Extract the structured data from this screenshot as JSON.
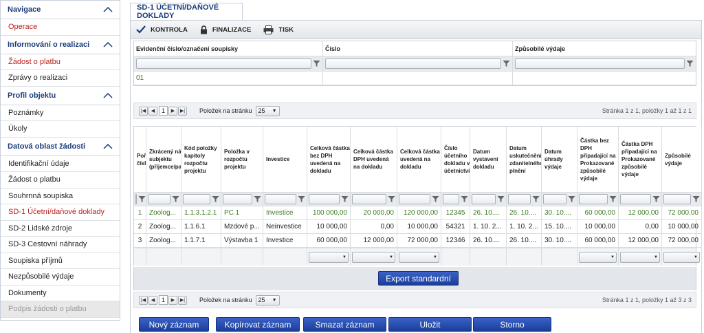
{
  "sidebar": {
    "sections": [
      {
        "title": "Navigace",
        "items": [
          {
            "label": "Operace",
            "state": "red"
          }
        ]
      },
      {
        "title": "Informování o realizaci",
        "items": [
          {
            "label": "Žádost o platbu",
            "state": "red"
          },
          {
            "label": "Zprávy o realizaci",
            "state": "normal"
          }
        ]
      },
      {
        "title": "Profil objektu",
        "items": [
          {
            "label": "Poznámky",
            "state": "normal"
          },
          {
            "label": "Úkoly",
            "state": "normal"
          }
        ]
      },
      {
        "title": "Datová oblast žádosti",
        "items": [
          {
            "label": "Identifikační údaje",
            "state": "normal"
          },
          {
            "label": "Žádost o platbu",
            "state": "normal"
          },
          {
            "label": "Souhrnná soupiska",
            "state": "normal"
          },
          {
            "label": "SD-1 Účetní/daňové doklady",
            "state": "red"
          },
          {
            "label": "SD-2 Lidské zdroje",
            "state": "normal"
          },
          {
            "label": "SD-3 Cestovní náhrady",
            "state": "normal"
          },
          {
            "label": "Soupiska příjmů",
            "state": "normal"
          },
          {
            "label": "Nezpůsobilé výdaje",
            "state": "normal"
          },
          {
            "label": "Dokumenty",
            "state": "normal"
          },
          {
            "label": "Podpis žádosti o platbu",
            "state": "disabled"
          }
        ]
      }
    ]
  },
  "tab": {
    "title": "SD-1 ÚČETNÍ/DAŇOVÉ DOKLADY"
  },
  "toolbar": {
    "kontrola": "KONTROLA",
    "finalizace": "FINALIZACE",
    "tisk": "TISK"
  },
  "filter_table": {
    "headers": [
      "Evidenční číslo/označení soupisky",
      "Číslo",
      "Způsobilé výdaje"
    ],
    "row": [
      "01",
      "",
      ""
    ]
  },
  "pager_top": {
    "per_page_label": "Položek na stránku",
    "per_page": "25",
    "page": "1",
    "info": "Stránka 1 z 1, položky 1 až 1 z 1"
  },
  "grid": {
    "headers": [
      "Pořadí číslo",
      "Zkrácený název subjektu (příjemce/partnera)",
      "Kód položky kapitoly rozpočtu projektu",
      "Položka v rozpočtu projektu",
      "Investice",
      "Celková částka bez DPH uvedená na dokladu",
      "Celková částka DPH uvedená na dokladu",
      "Celková částka uvedená na dokladu",
      "Číslo účetního dokladu v účetnictví",
      "Datum vystavení dokladu",
      "Datum uskutečnění zdanitelného plnění",
      "Datum úhrady výdaje",
      "Částka bez DPH připadající na Prokazované způsobilé výdaje",
      "Částka DPH připadající na Prokazované způsobilé výdaje",
      "Způsobilé výdaje"
    ],
    "rows": [
      [
        "1",
        "Zoolog...",
        "1.1.3.1.2.1",
        "PC 1",
        "Investice",
        "100 000,00",
        "20 000,00",
        "120 000,00",
        "12345",
        "26. 10....",
        "26. 10....",
        "30. 10....",
        "60 000,00",
        "12 000,00",
        "72 000,00"
      ],
      [
        "2",
        "Zoolog...",
        "1.1.6.1",
        "Mzdové p...",
        "Neinvestice",
        "10 000,00",
        "0,00",
        "10 000,00",
        "54321",
        "1. 10. 2...",
        "1. 10. 2...",
        "15. 10....",
        "10 000,00",
        "0,00",
        "10 000,00"
      ],
      [
        "3",
        "Zoolog...",
        "1.1.7.1",
        "Výstavba 1",
        "Investice",
        "60 000,00",
        "12 000,00",
        "72 000,00",
        "12346",
        "26. 10....",
        "26. 10....",
        "30. 10....",
        "60 000,00",
        "12 000,00",
        "72 000,00"
      ]
    ]
  },
  "export_button": "Export standardní",
  "pager_bottom": {
    "per_page_label": "Položek na stránku",
    "per_page": "25",
    "page": "1",
    "info": "Stránka 1 z 1, položky 1 až 3 z 3"
  },
  "actions": {
    "new": "Nový záznam",
    "copy": "Kopírovat záznam",
    "delete": "Smazat záznam",
    "save": "Uložit",
    "cancel": "Storno"
  },
  "colors": {
    "accent": "#1b3d9a",
    "link_red": "#b8221f",
    "selected_text": "#3a7a1f"
  }
}
